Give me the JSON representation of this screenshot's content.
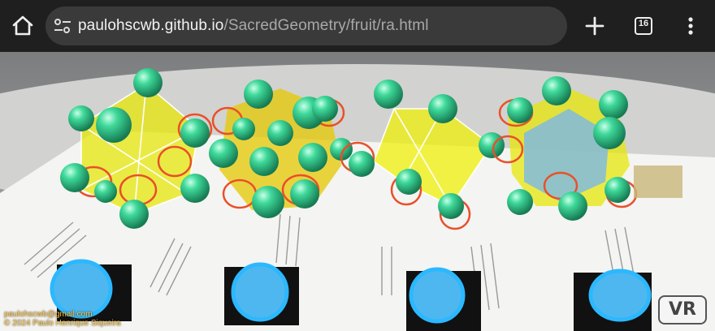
{
  "browser": {
    "url_host": "paulohscwb.github.io",
    "url_path": "/SacredGeometry/fruit/ra.html",
    "tab_count": "16",
    "icons": [
      "home-icon",
      "site-settings-icon",
      "plus-icon",
      "tab-switcher-icon",
      "more-vert-icon"
    ]
  },
  "scene": {
    "credit_email": "paulohscwb@gmail.com",
    "credit_copyright": "© 2024 Paulo Henrique Siqueira",
    "vr_label": "VR"
  },
  "colors": {
    "toolbar": "#1f1f1f",
    "urlbar": "#3a3a3a",
    "solid_yellow": "#e6e600",
    "solid_blue": "#7ab8e8",
    "sphere_green": "#2ecc8e",
    "circle_red": "#e8502a",
    "marker_ring": "#2bb8ff",
    "credit_text": "#ffc84a"
  }
}
